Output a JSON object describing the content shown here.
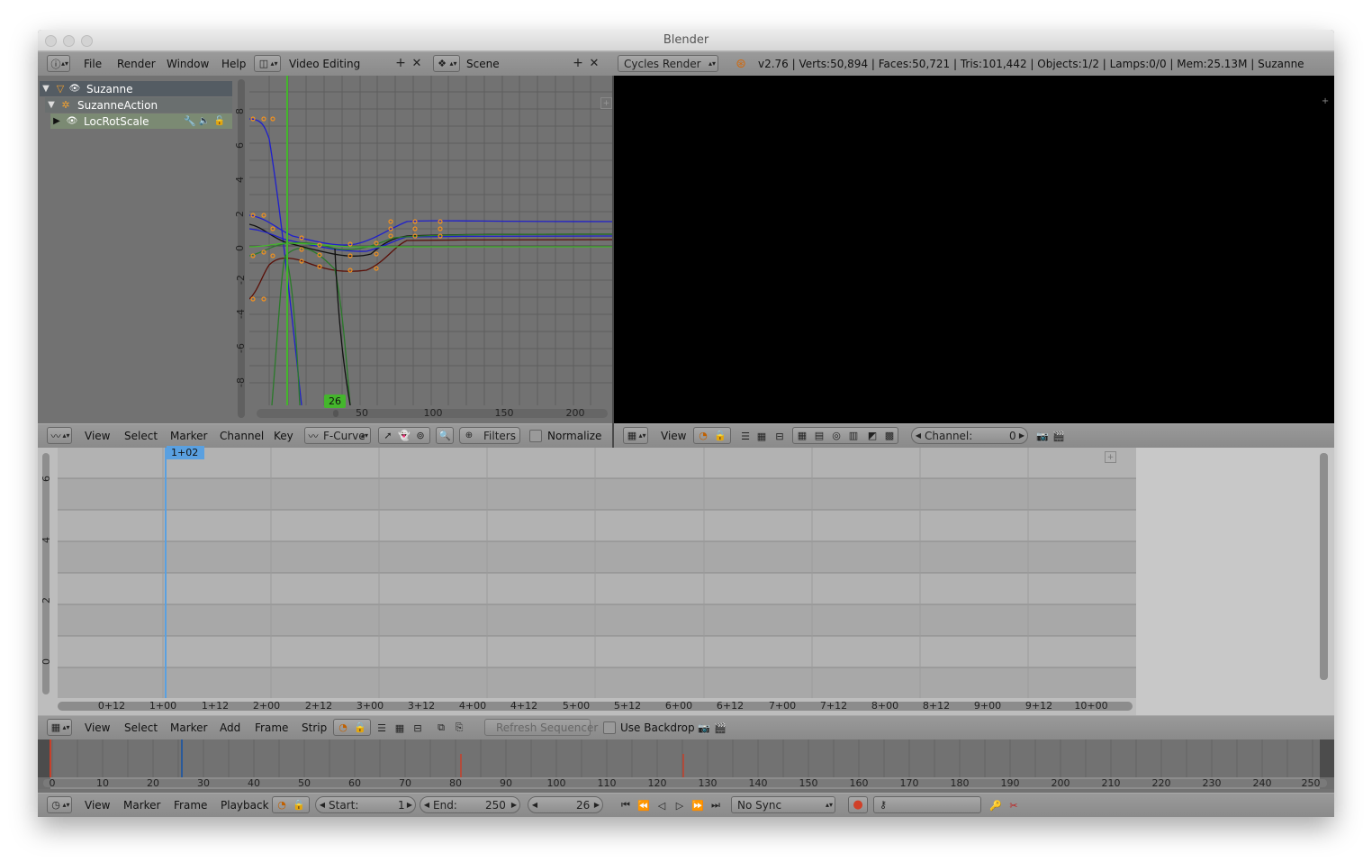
{
  "window": {
    "title": "Blender"
  },
  "topbar": {
    "menus": [
      "File",
      "Render",
      "Window",
      "Help"
    ],
    "screen_layout": "Video Editing",
    "scene": "Scene",
    "engine": "Cycles Render",
    "stats": "v2.76 | Verts:50,894 | Faces:50,721 | Tris:101,442 | Objects:1/2 | Lamps:0/0 | Mem:25.13M | Suzanne"
  },
  "outliner": {
    "items": [
      {
        "label": "Suzanne",
        "icon": "mesh-object-icon"
      },
      {
        "label": "SuzanneAction",
        "icon": "action-icon"
      },
      {
        "label": "LocRotScale",
        "icon": "group-icon"
      }
    ]
  },
  "graph_editor": {
    "current_frame": "26",
    "x_ticks": [
      "50",
      "100",
      "150",
      "200"
    ],
    "y_ticks": [
      "8",
      "6",
      "4",
      "2",
      "0",
      "-2",
      "-4",
      "-6",
      "-8"
    ],
    "header": {
      "menus": [
        "View",
        "Select",
        "Marker",
        "Channel",
        "Key"
      ],
      "mode": "F-Curve",
      "filters_label": "Filters",
      "normalize_label": "Normalize"
    }
  },
  "preview": {
    "header": {
      "view_label": "View",
      "channel_label": "Channel:",
      "channel_value": "0"
    }
  },
  "sequencer": {
    "current_time": "1+02",
    "y_ticks": [
      "6",
      "4",
      "2",
      "0"
    ],
    "x_ticks": [
      "0+12",
      "1+00",
      "1+12",
      "2+00",
      "2+12",
      "3+00",
      "3+12",
      "4+00",
      "4+12",
      "5+00",
      "5+12",
      "6+00",
      "6+12",
      "7+00",
      "7+12",
      "8+00",
      "8+12",
      "9+00",
      "9+12",
      "10+00"
    ],
    "header": {
      "menus": [
        "View",
        "Select",
        "Marker",
        "Add",
        "Frame",
        "Strip"
      ],
      "refresh_label": "Refresh Sequencer",
      "backdrop_label": "Use Backdrop"
    }
  },
  "timeline": {
    "ticks": [
      "0",
      "10",
      "20",
      "30",
      "40",
      "50",
      "60",
      "70",
      "80",
      "90",
      "100",
      "110",
      "120",
      "130",
      "140",
      "150",
      "160",
      "170",
      "180",
      "190",
      "200",
      "210",
      "220",
      "230",
      "240",
      "250"
    ],
    "header": {
      "menus": [
        "View",
        "Marker",
        "Frame",
        "Playback"
      ],
      "start_label": "Start:",
      "start_value": "1",
      "end_label": "End:",
      "end_value": "250",
      "current_frame": "26",
      "sync": "No Sync"
    }
  },
  "colors": {
    "accent_blue": "#5aa0e0",
    "frame_green": "#44b62c",
    "keyframe_orange": "#f09020",
    "record_red": "#d04028"
  }
}
